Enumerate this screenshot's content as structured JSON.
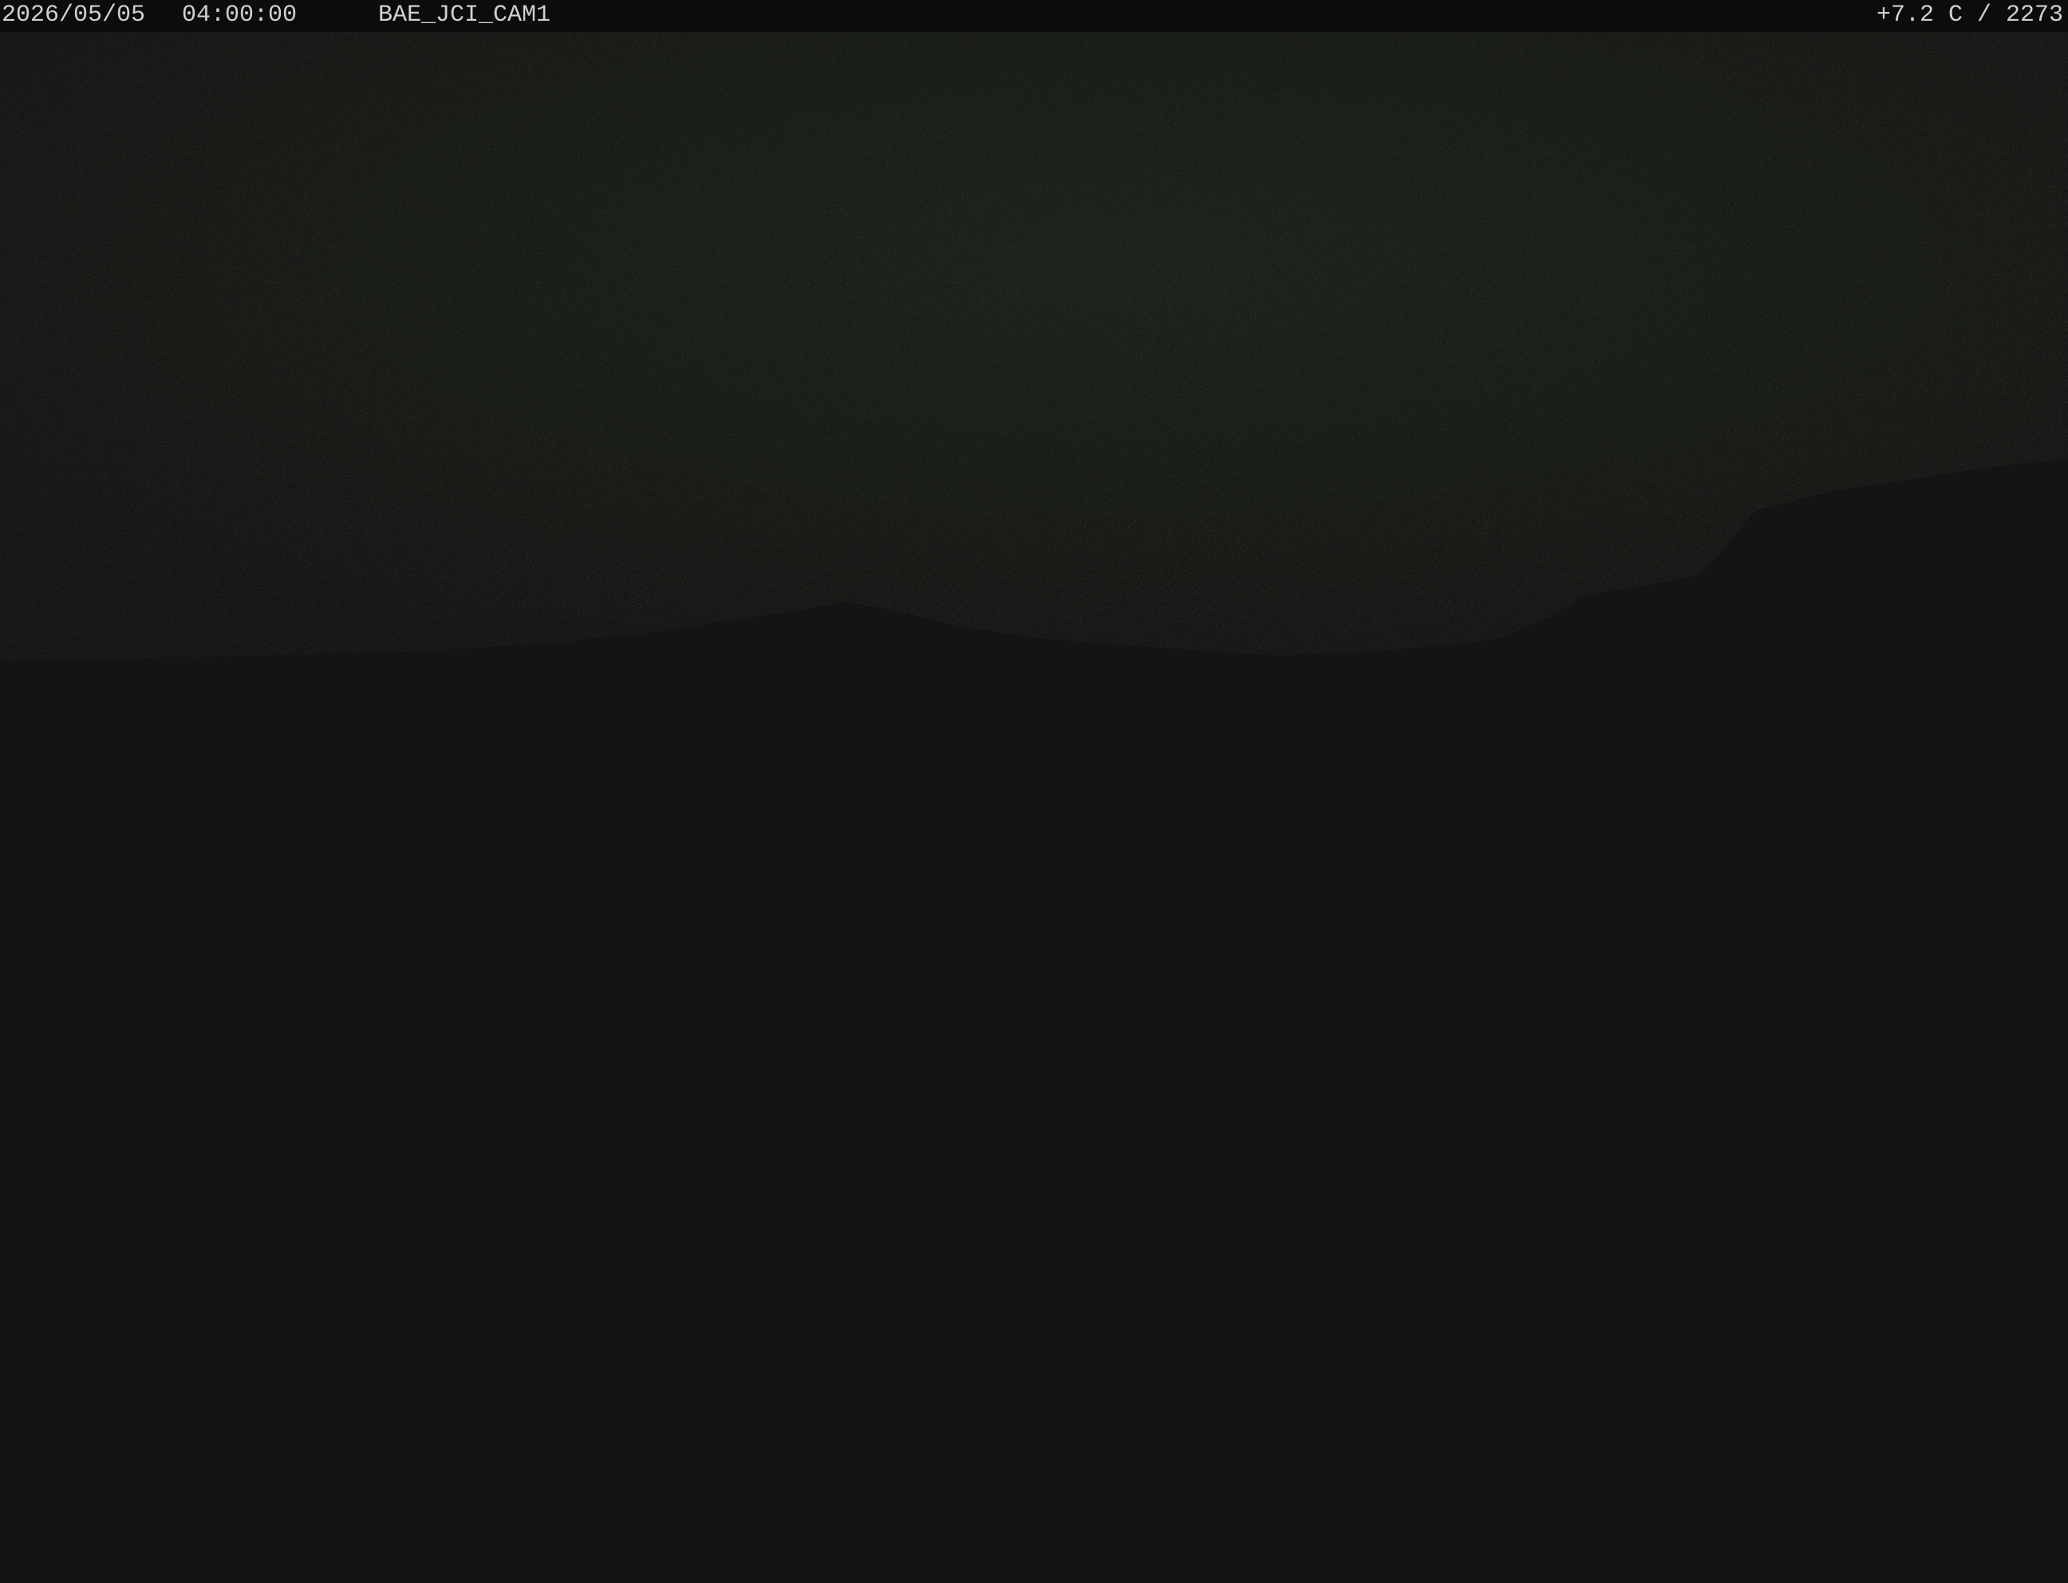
{
  "overlay": {
    "date": "2026/05/05",
    "time": "04:00:00",
    "camera_id": "BAE_JCI_CAM1",
    "temperature_readout": "+7.2 C / 2273"
  },
  "scene": {
    "description_colors": {
      "sky": "#161816",
      "ground": "#141414",
      "noise_green": "#3f6a2a"
    }
  }
}
